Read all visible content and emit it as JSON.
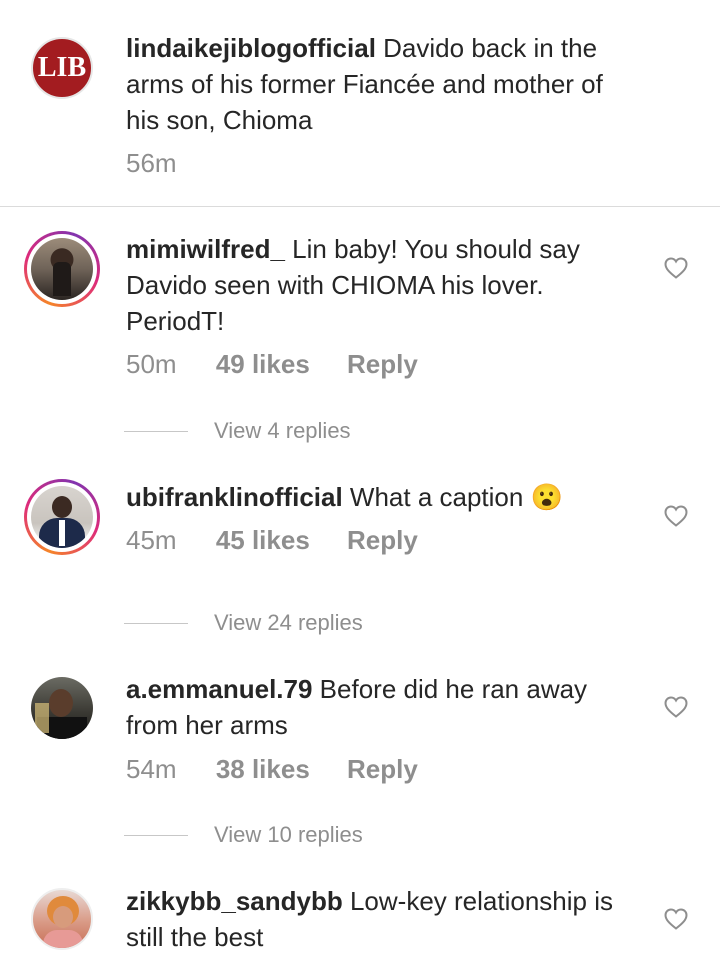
{
  "caption": {
    "username": "lindaikejiblogofficial",
    "text": "Davido back in the arms of his former Fiancée and mother of his son, Chioma",
    "time": "56m",
    "avatar_label": "LIB"
  },
  "comments": [
    {
      "username": "mimiwilfred_",
      "text": "Lin baby! You should say Davido seen with CHIOMA his lover. PeriodT!",
      "time": "50m",
      "likes": "49 likes",
      "reply": "Reply",
      "view_replies": "View 4 replies"
    },
    {
      "username": "ubifranklinofficial",
      "text": "What a caption",
      "emoji": "😮",
      "time": "45m",
      "likes": "45 likes",
      "reply": "Reply",
      "view_replies": "View 24 replies"
    },
    {
      "username": "a.emmanuel.79",
      "text": "Before did he ran away from her arms",
      "time": "54m",
      "likes": "38 likes",
      "reply": "Reply",
      "view_replies": "View 10 replies"
    },
    {
      "username": "zikkybb_sandybb",
      "text": "Low-key relationship is still the best"
    }
  ],
  "colors": {
    "lib_red": "#a31c20",
    "meta_gray": "#8e8e8e",
    "divider": "#dbdbdb"
  },
  "icons": {
    "like": "heart-outline-icon"
  }
}
